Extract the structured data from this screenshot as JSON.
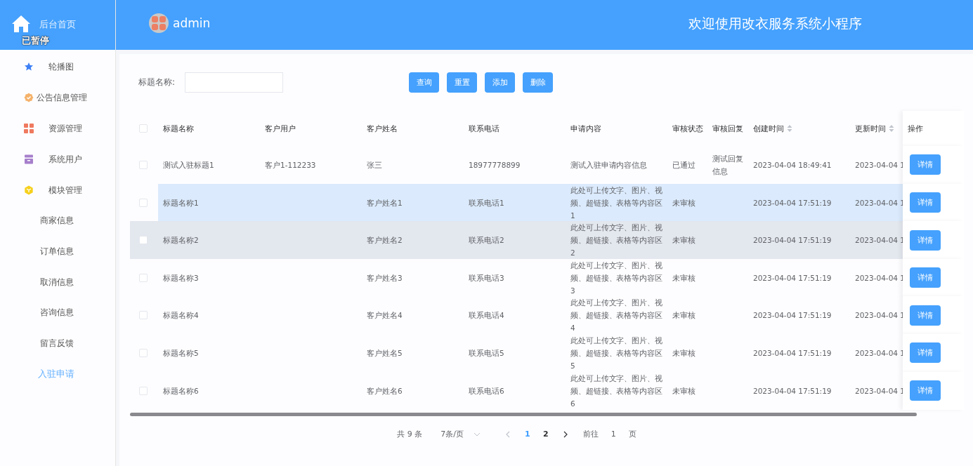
{
  "sidebar": {
    "home": {
      "label": "后台首页"
    },
    "overlay": "已暂停",
    "items": [
      {
        "label": "轮播图",
        "selected": false
      },
      {
        "label": "公告信息管理",
        "selected": false
      },
      {
        "label": "资源管理",
        "selected": false
      },
      {
        "label": "系统用户",
        "selected": false
      },
      {
        "label": "模块管理",
        "selected": false,
        "children": [
          {
            "label": "商家信息",
            "selected": false
          },
          {
            "label": "订单信息",
            "selected": false
          },
          {
            "label": "取消信息",
            "selected": false
          },
          {
            "label": "咨询信息",
            "selected": false
          },
          {
            "label": "留言反馈",
            "selected": false
          },
          {
            "label": "入驻申请",
            "selected": true
          }
        ]
      }
    ]
  },
  "header": {
    "user": "admin",
    "title": "欢迎使用改衣服务系统小程序"
  },
  "search": {
    "label": "标题名称:",
    "buttons": [
      "查询",
      "重置",
      "添加",
      "删除"
    ]
  },
  "table": {
    "columns": [
      {
        "label": "标题名称",
        "sortable": false
      },
      {
        "label": "客户用户",
        "sortable": false
      },
      {
        "label": "客户姓名",
        "sortable": false
      },
      {
        "label": "联系电话",
        "sortable": false
      },
      {
        "label": "申请内容",
        "sortable": false
      },
      {
        "label": "审核状态",
        "sortable": false
      },
      {
        "label": "审核回复",
        "sortable": false
      },
      {
        "label": "创建时间",
        "sortable": true
      },
      {
        "label": "更新时间",
        "sortable": true
      }
    ],
    "action_column": "操作",
    "select_all_checked": false,
    "rows": [
      {
        "checked": false,
        "hovered": false,
        "striped": false,
        "cells": [
          "测试入驻标题1",
          "客户1-112233",
          "张三",
          "18977778899",
          "测试入驻申请内容信息",
          "已通过",
          "测试回复信息",
          "2023-04-04 18:49:41",
          "2023-04-04 1"
        ],
        "action": "详情"
      },
      {
        "checked": false,
        "hovered": true,
        "striped": false,
        "cells": [
          "标题名称1",
          "",
          "客户姓名1",
          "联系电话1",
          "此处可上传文字、图片、视频、超链接、表格等内容区1",
          "未审核",
          "",
          "2023-04-04 17:51:19",
          "2023-04-04 1"
        ],
        "action": "详情"
      },
      {
        "checked": false,
        "hovered": false,
        "striped": true,
        "cells": [
          "标题名称2",
          "",
          "客户姓名2",
          "联系电话2",
          "此处可上传文字、图片、视频、超链接、表格等内容区2",
          "未审核",
          "",
          "2023-04-04 17:51:19",
          "2023-04-04 1"
        ],
        "action": "详情"
      },
      {
        "checked": false,
        "hovered": false,
        "striped": false,
        "cells": [
          "标题名称3",
          "",
          "客户姓名3",
          "联系电话3",
          "此处可上传文字、图片、视频、超链接、表格等内容区3",
          "未审核",
          "",
          "2023-04-04 17:51:19",
          "2023-04-04 1"
        ],
        "action": "详情"
      },
      {
        "checked": false,
        "hovered": false,
        "striped": false,
        "cells": [
          "标题名称4",
          "",
          "客户姓名4",
          "联系电话4",
          "此处可上传文字、图片、视频、超链接、表格等内容区4",
          "未审核",
          "",
          "2023-04-04 17:51:19",
          "2023-04-04 1"
        ],
        "action": "详情"
      },
      {
        "checked": false,
        "hovered": false,
        "striped": false,
        "cells": [
          "标题名称5",
          "",
          "客户姓名5",
          "联系电话5",
          "此处可上传文字、图片、视频、超链接、表格等内容区5",
          "未审核",
          "",
          "2023-04-04 17:51:19",
          "2023-04-04 1"
        ],
        "action": "详情"
      },
      {
        "checked": false,
        "hovered": false,
        "striped": false,
        "cells": [
          "标题名称6",
          "",
          "客户姓名6",
          "联系电话6",
          "此处可上传文字、图片、视频、超链接、表格等内容区6",
          "未审核",
          "",
          "2023-04-04 17:51:19",
          "2023-04-04 1"
        ],
        "action": "详情"
      }
    ]
  },
  "pagination": {
    "total": "共 9 条",
    "page_size": "7条/页",
    "pages": [
      {
        "label": "1",
        "selected": true
      },
      {
        "label": "2",
        "selected": false
      }
    ],
    "goto": "前往",
    "goto_value": "1",
    "goto_suffix": "页"
  }
}
